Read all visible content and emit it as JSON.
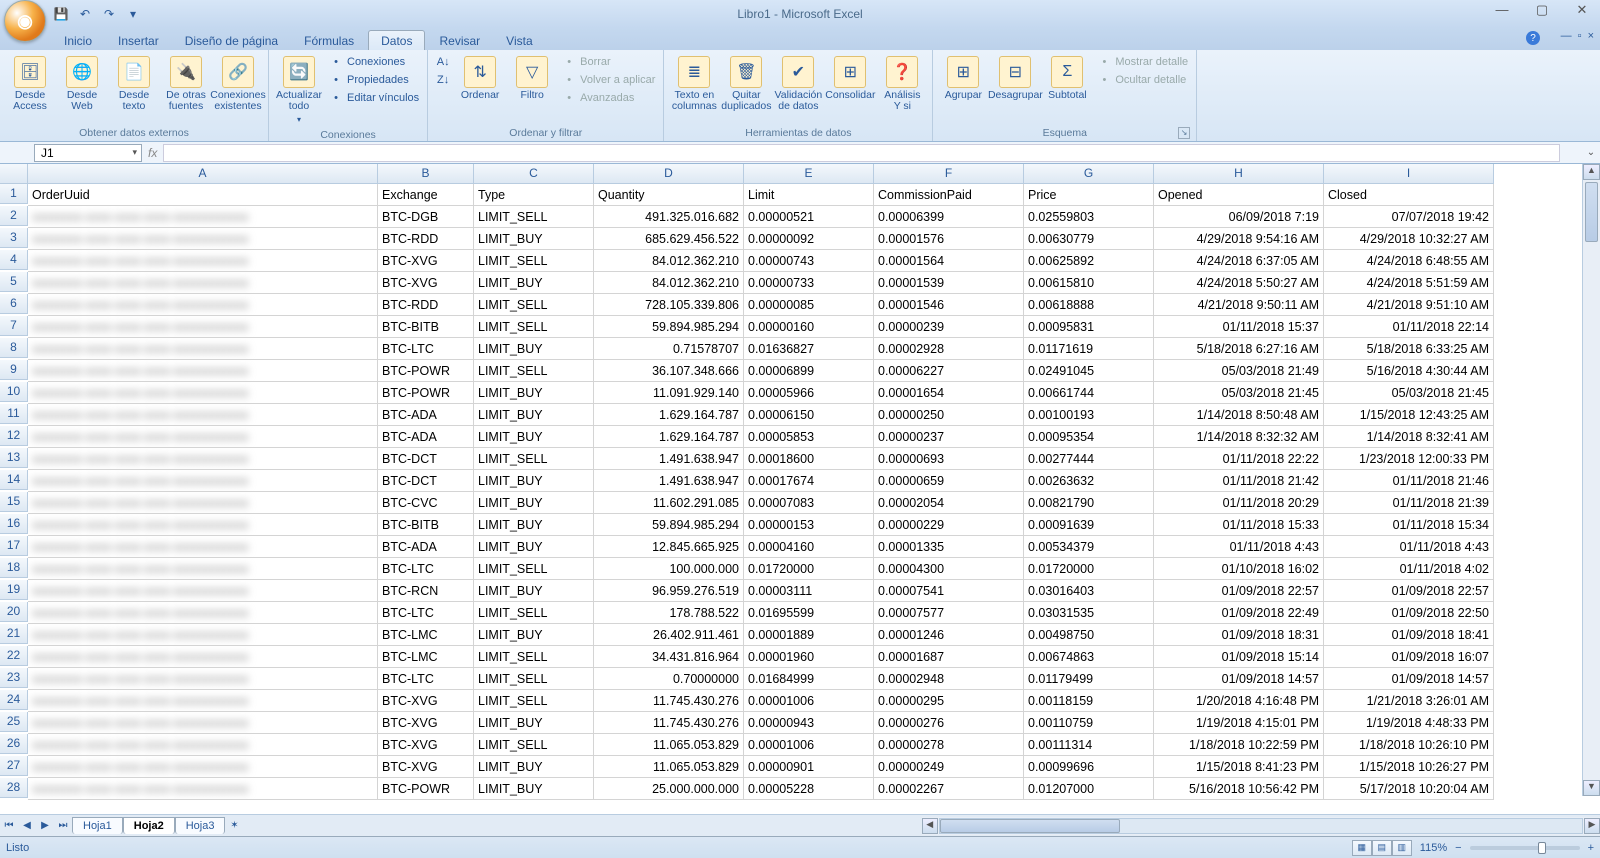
{
  "app": {
    "title": "Libro1 - Microsoft Excel"
  },
  "qat": {
    "save": "💾",
    "undo": "↶",
    "redo": "↷"
  },
  "tabs": [
    "Inicio",
    "Insertar",
    "Diseño de página",
    "Fórmulas",
    "Datos",
    "Revisar",
    "Vista"
  ],
  "active_tab": 4,
  "ribbon": {
    "g1": {
      "label": "Obtener datos externos",
      "btns": [
        "Desde Access",
        "Desde Web",
        "Desde texto",
        "De otras fuentes",
        "Conexiones existentes"
      ]
    },
    "g2": {
      "label": "Conexiones",
      "big": "Actualizar todo",
      "small": [
        "Conexiones",
        "Propiedades",
        "Editar vínculos"
      ]
    },
    "g3": {
      "label": "Ordenar y filtrar",
      "sort": "Ordenar",
      "filter": "Filtro",
      "small": [
        "Borrar",
        "Volver a aplicar",
        "Avanzadas"
      ]
    },
    "g4": {
      "label": "Herramientas de datos",
      "btns": [
        "Texto en columnas",
        "Quitar duplicados",
        "Validación de datos",
        "Consolidar",
        "Análisis Y si"
      ]
    },
    "g5": {
      "label": "Esquema",
      "btns": [
        "Agrupar",
        "Desagrupar",
        "Subtotal"
      ],
      "small": [
        "Mostrar detalle",
        "Ocultar detalle"
      ]
    }
  },
  "namebox": "J1",
  "columns": [
    "A",
    "B",
    "C",
    "D",
    "E",
    "F",
    "G",
    "H",
    "I"
  ],
  "headers": [
    "OrderUuid",
    "Exchange",
    "Type",
    "Quantity",
    "Limit",
    "CommissionPaid",
    "Price",
    "Opened",
    "Closed"
  ],
  "rows": [
    {
      "n": 2,
      "ex": "BTC-DGB",
      "ty": "LIMIT_SELL",
      "q": "491.325.016.682",
      "l": "0.00000521",
      "c": "0.00006399",
      "p": "0.02559803",
      "o": "06/09/2018 7:19",
      "cl": "07/07/2018 19:42"
    },
    {
      "n": 3,
      "ex": "BTC-RDD",
      "ty": "LIMIT_BUY",
      "q": "685.629.456.522",
      "l": "0.00000092",
      "c": "0.00001576",
      "p": "0.00630779",
      "o": "4/29/2018 9:54:16 AM",
      "cl": "4/29/2018 10:32:27 AM"
    },
    {
      "n": 4,
      "ex": "BTC-XVG",
      "ty": "LIMIT_SELL",
      "q": "84.012.362.210",
      "l": "0.00000743",
      "c": "0.00001564",
      "p": "0.00625892",
      "o": "4/24/2018 6:37:05 AM",
      "cl": "4/24/2018 6:48:55 AM"
    },
    {
      "n": 5,
      "ex": "BTC-XVG",
      "ty": "LIMIT_BUY",
      "q": "84.012.362.210",
      "l": "0.00000733",
      "c": "0.00001539",
      "p": "0.00615810",
      "o": "4/24/2018 5:50:27 AM",
      "cl": "4/24/2018 5:51:59 AM"
    },
    {
      "n": 6,
      "ex": "BTC-RDD",
      "ty": "LIMIT_SELL",
      "q": "728.105.339.806",
      "l": "0.00000085",
      "c": "0.00001546",
      "p": "0.00618888",
      "o": "4/21/2018 9:50:11 AM",
      "cl": "4/21/2018 9:51:10 AM"
    },
    {
      "n": 7,
      "ex": "BTC-BITB",
      "ty": "LIMIT_SELL",
      "q": "59.894.985.294",
      "l": "0.00000160",
      "c": "0.00000239",
      "p": "0.00095831",
      "o": "01/11/2018 15:37",
      "cl": "01/11/2018 22:14"
    },
    {
      "n": 8,
      "ex": "BTC-LTC",
      "ty": "LIMIT_BUY",
      "q": "0.71578707",
      "l": "0.01636827",
      "c": "0.00002928",
      "p": "0.01171619",
      "o": "5/18/2018 6:27:16 AM",
      "cl": "5/18/2018 6:33:25 AM"
    },
    {
      "n": 9,
      "ex": "BTC-POWR",
      "ty": "LIMIT_SELL",
      "q": "36.107.348.666",
      "l": "0.00006899",
      "c": "0.00006227",
      "p": "0.02491045",
      "o": "05/03/2018 21:49",
      "cl": "5/16/2018 4:30:44 AM"
    },
    {
      "n": 10,
      "ex": "BTC-POWR",
      "ty": "LIMIT_BUY",
      "q": "11.091.929.140",
      "l": "0.00005966",
      "c": "0.00001654",
      "p": "0.00661744",
      "o": "05/03/2018 21:45",
      "cl": "05/03/2018 21:45"
    },
    {
      "n": 11,
      "ex": "BTC-ADA",
      "ty": "LIMIT_BUY",
      "q": "1.629.164.787",
      "l": "0.00006150",
      "c": "0.00000250",
      "p": "0.00100193",
      "o": "1/14/2018 8:50:48 AM",
      "cl": "1/15/2018 12:43:25 AM"
    },
    {
      "n": 12,
      "ex": "BTC-ADA",
      "ty": "LIMIT_BUY",
      "q": "1.629.164.787",
      "l": "0.00005853",
      "c": "0.00000237",
      "p": "0.00095354",
      "o": "1/14/2018 8:32:32 AM",
      "cl": "1/14/2018 8:32:41 AM"
    },
    {
      "n": 13,
      "ex": "BTC-DCT",
      "ty": "LIMIT_SELL",
      "q": "1.491.638.947",
      "l": "0.00018600",
      "c": "0.00000693",
      "p": "0.00277444",
      "o": "01/11/2018 22:22",
      "cl": "1/23/2018 12:00:33 PM"
    },
    {
      "n": 14,
      "ex": "BTC-DCT",
      "ty": "LIMIT_BUY",
      "q": "1.491.638.947",
      "l": "0.00017674",
      "c": "0.00000659",
      "p": "0.00263632",
      "o": "01/11/2018 21:42",
      "cl": "01/11/2018 21:46"
    },
    {
      "n": 15,
      "ex": "BTC-CVC",
      "ty": "LIMIT_BUY",
      "q": "11.602.291.085",
      "l": "0.00007083",
      "c": "0.00002054",
      "p": "0.00821790",
      "o": "01/11/2018 20:29",
      "cl": "01/11/2018 21:39"
    },
    {
      "n": 16,
      "ex": "BTC-BITB",
      "ty": "LIMIT_BUY",
      "q": "59.894.985.294",
      "l": "0.00000153",
      "c": "0.00000229",
      "p": "0.00091639",
      "o": "01/11/2018 15:33",
      "cl": "01/11/2018 15:34"
    },
    {
      "n": 17,
      "ex": "BTC-ADA",
      "ty": "LIMIT_BUY",
      "q": "12.845.665.925",
      "l": "0.00004160",
      "c": "0.00001335",
      "p": "0.00534379",
      "o": "01/11/2018 4:43",
      "cl": "01/11/2018 4:43"
    },
    {
      "n": 18,
      "ex": "BTC-LTC",
      "ty": "LIMIT_SELL",
      "q": "100.000.000",
      "l": "0.01720000",
      "c": "0.00004300",
      "p": "0.01720000",
      "o": "01/10/2018 16:02",
      "cl": "01/11/2018 4:02"
    },
    {
      "n": 19,
      "ex": "BTC-RCN",
      "ty": "LIMIT_BUY",
      "q": "96.959.276.519",
      "l": "0.00003111",
      "c": "0.00007541",
      "p": "0.03016403",
      "o": "01/09/2018 22:57",
      "cl": "01/09/2018 22:57"
    },
    {
      "n": 20,
      "ex": "BTC-LTC",
      "ty": "LIMIT_SELL",
      "q": "178.788.522",
      "l": "0.01695599",
      "c": "0.00007577",
      "p": "0.03031535",
      "o": "01/09/2018 22:49",
      "cl": "01/09/2018 22:50"
    },
    {
      "n": 21,
      "ex": "BTC-LMC",
      "ty": "LIMIT_BUY",
      "q": "26.402.911.461",
      "l": "0.00001889",
      "c": "0.00001246",
      "p": "0.00498750",
      "o": "01/09/2018 18:31",
      "cl": "01/09/2018 18:41"
    },
    {
      "n": 22,
      "ex": "BTC-LMC",
      "ty": "LIMIT_SELL",
      "q": "34.431.816.964",
      "l": "0.00001960",
      "c": "0.00001687",
      "p": "0.00674863",
      "o": "01/09/2018 15:14",
      "cl": "01/09/2018 16:07"
    },
    {
      "n": 23,
      "ex": "BTC-LTC",
      "ty": "LIMIT_SELL",
      "q": "0.70000000",
      "l": "0.01684999",
      "c": "0.00002948",
      "p": "0.01179499",
      "o": "01/09/2018 14:57",
      "cl": "01/09/2018 14:57"
    },
    {
      "n": 24,
      "ex": "BTC-XVG",
      "ty": "LIMIT_SELL",
      "q": "11.745.430.276",
      "l": "0.00001006",
      "c": "0.00000295",
      "p": "0.00118159",
      "o": "1/20/2018 4:16:48 PM",
      "cl": "1/21/2018 3:26:01 AM"
    },
    {
      "n": 25,
      "ex": "BTC-XVG",
      "ty": "LIMIT_BUY",
      "q": "11.745.430.276",
      "l": "0.00000943",
      "c": "0.00000276",
      "p": "0.00110759",
      "o": "1/19/2018 4:15:01 PM",
      "cl": "1/19/2018 4:48:33 PM"
    },
    {
      "n": 26,
      "ex": "BTC-XVG",
      "ty": "LIMIT_SELL",
      "q": "11.065.053.829",
      "l": "0.00001006",
      "c": "0.00000278",
      "p": "0.00111314",
      "o": "1/18/2018 10:22:59 PM",
      "cl": "1/18/2018 10:26:10 PM"
    },
    {
      "n": 27,
      "ex": "BTC-XVG",
      "ty": "LIMIT_BUY",
      "q": "11.065.053.829",
      "l": "0.00000901",
      "c": "0.00000249",
      "p": "0.00099696",
      "o": "1/15/2018 8:41:23 PM",
      "cl": "1/15/2018 10:26:27 PM"
    },
    {
      "n": 28,
      "ex": "BTC-POWR",
      "ty": "LIMIT_BUY",
      "q": "25.000.000.000",
      "l": "0.00005228",
      "c": "0.00002267",
      "p": "0.01207000",
      "o": "5/16/2018 10:56:42 PM",
      "cl": "5/17/2018 10:20:04 AM"
    }
  ],
  "sheets": [
    "Hoja1",
    "Hoja2",
    "Hoja3"
  ],
  "active_sheet": 1,
  "status": {
    "ready": "Listo",
    "zoom": "115%"
  }
}
